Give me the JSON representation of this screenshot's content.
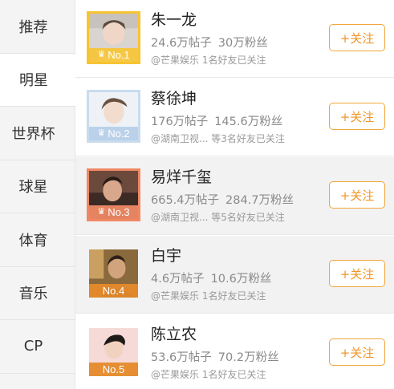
{
  "sidebar": {
    "items": [
      {
        "label": "推荐"
      },
      {
        "label": "明星"
      },
      {
        "label": "世界杯"
      },
      {
        "label": "球星"
      },
      {
        "label": "体育"
      },
      {
        "label": "音乐"
      },
      {
        "label": "CP"
      }
    ]
  },
  "list": [
    {
      "name": "朱一龙",
      "posts": "24.6万帖子",
      "fans": "30万粉丝",
      "friends": "@芒果娱乐 1名好友已关注",
      "rank": "No.1",
      "follow": "+关注",
      "rank_color": "#f7c432",
      "crown": true
    },
    {
      "name": "蔡徐坤",
      "posts": "176万帖子",
      "fans": "145.6万粉丝",
      "friends": "@湖南卫视... 等3名好友已关注",
      "rank": "No.2",
      "follow": "+关注",
      "rank_color": "#b6cfe8",
      "crown": true
    },
    {
      "name": "易烊千玺",
      "posts": "665.4万帖子",
      "fans": "284.7万粉丝",
      "friends": "@湖南卫视... 等5名好友已关注",
      "rank": "No.3",
      "follow": "+关注",
      "rank_color": "#ef8864",
      "crown": true
    },
    {
      "name": "白宇",
      "posts": "4.6万帖子",
      "fans": "10.6万粉丝",
      "friends": "@芒果娱乐 1名好友已关注",
      "rank": "No.4",
      "follow": "+关注",
      "rank_color": "#e58a2a",
      "crown": false
    },
    {
      "name": "陈立农",
      "posts": "53.6万帖子",
      "fans": "70.2万粉丝",
      "friends": "@芒果娱乐 1名好友已关注",
      "rank": "No.5",
      "follow": "+关注",
      "rank_color": "#e58a2a",
      "crown": false
    }
  ]
}
